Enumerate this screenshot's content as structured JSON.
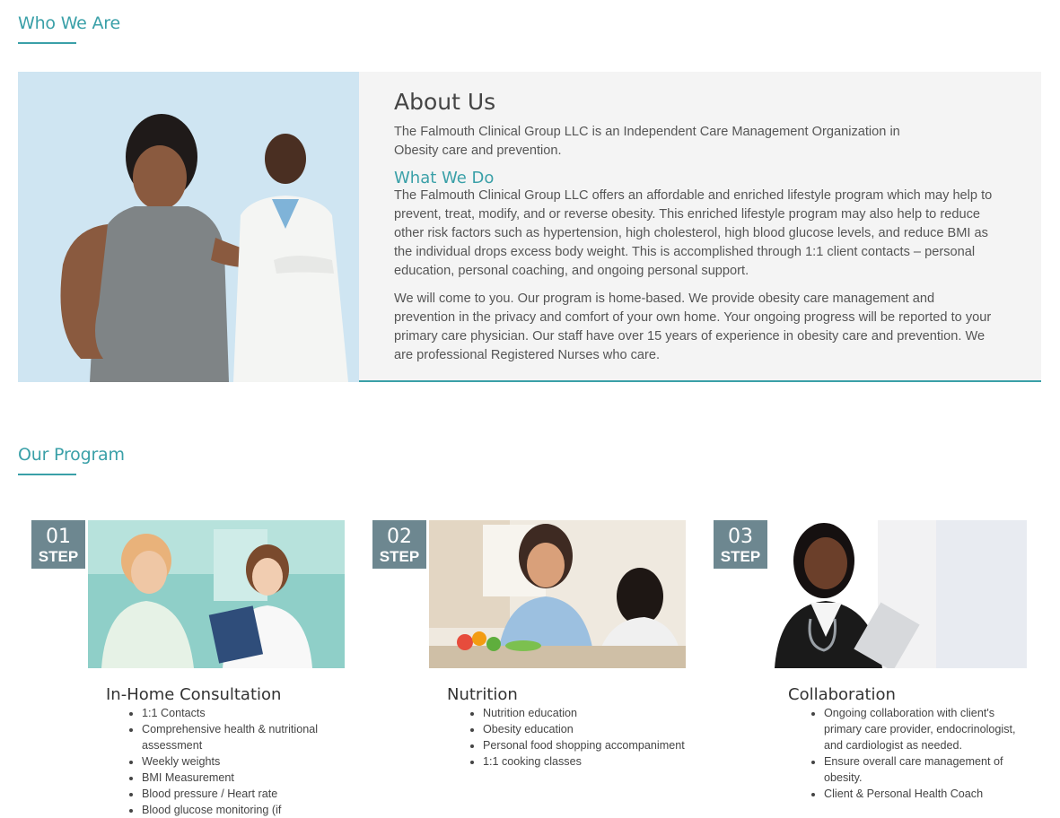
{
  "who_we_are": {
    "title": "Who We Are"
  },
  "about": {
    "heading": "About Us",
    "intro": "The Falmouth Clinical Group LLC is an Independent Care Management Organization in Obesity care and prevention.",
    "what_we_do_heading": "What We Do",
    "paragraph1": "The Falmouth Clinical Group LLC offers an affordable and enriched lifestyle program which may help to prevent, treat, modify, and or reverse obesity. This enriched lifestyle program may also help to reduce other risk factors such as hypertension, high cholesterol, high blood glucose levels, and reduce BMI as the individual drops excess body weight. This is accomplished through 1:1 client contacts – personal education, personal coaching, and ongoing personal support.",
    "paragraph2": "We will come to you. Our program is home-based. We provide obesity care management and prevention in the privacy and comfort of your own home. Your ongoing progress will be reported to your primary care physician. Our staff have over 15 years of experience in obesity care and prevention. We are professional Registered Nurses who care."
  },
  "program": {
    "title": "Our Program",
    "step_word": "STEP",
    "cards": [
      {
        "number": "01",
        "title": "In-Home Consultation",
        "items": [
          "1:1 Contacts",
          "Comprehensive health & nutritional assessment",
          "Weekly weights",
          "BMI Measurement",
          "Blood pressure / Heart rate",
          "Blood glucose monitoring (if"
        ]
      },
      {
        "number": "02",
        "title": "Nutrition",
        "items": [
          "Nutrition education",
          "Obesity education",
          "Personal food shopping accompaniment",
          "1:1 cooking classes"
        ]
      },
      {
        "number": "03",
        "title": "Collaboration",
        "items": [
          "Ongoing collaboration with client's primary care provider, endocrinologist, and cardiologist as needed.",
          "Ensure overall care management of obesity.",
          "Client & Personal Health Coach"
        ]
      }
    ]
  },
  "colors": {
    "accent": "#3aa0a8",
    "badge": "#6d8790",
    "panel": "#f4f4f4"
  }
}
